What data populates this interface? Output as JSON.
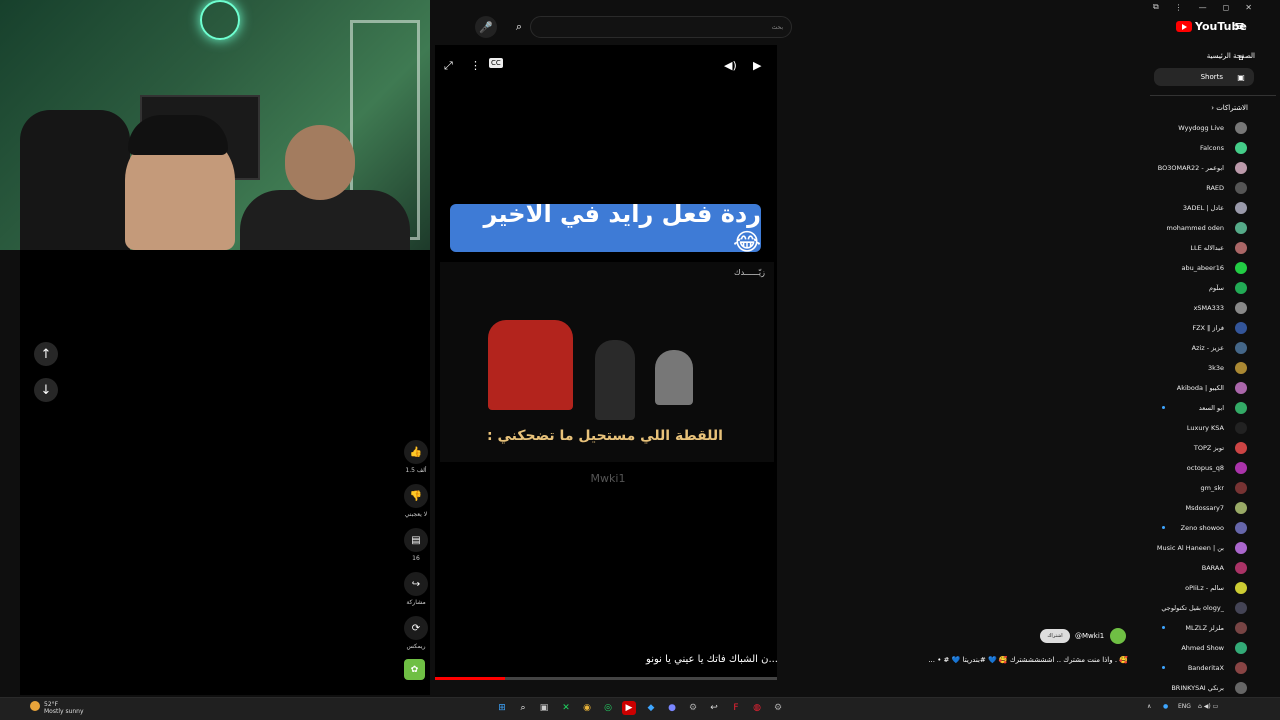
{
  "youtube": {
    "brand": "YouTube",
    "search_text": "بحث",
    "nav_home": "الصفحة الرئيسية",
    "nav_shorts": "Shorts",
    "subs_header": "الاشتراكات"
  },
  "video": {
    "top_caption": "ردة فعل رايد في الاخير 😂",
    "subtitle": "اللقطة اللي مستحيل ما تضحكني :",
    "watermark": "Mwki1",
    "bottom_text": "...ن الشباك فاتك يا عيني يا نونو",
    "progress": 0.205
  },
  "actions": {
    "like_count": "1.5 ألف",
    "dislike_label": "لا يعجبني",
    "comment_count": "16",
    "share_label": "مشاركة",
    "remix_label": "ريمكس"
  },
  "subscriptions": [
    "Wyydogg Live",
    "Falcons",
    "BO3OMAR22 - ابوعمر",
    "RAED",
    "3ADEL | عادل",
    "mohammed oden",
    "LLE عبدالاله",
    "abu_abeer16",
    "سلّوم",
    "xSMA333",
    "FZX ‖ فراز",
    "Aziz - عزيز",
    "3k3e",
    "Akiboda | الكيبو",
    "ابو السعد",
    "Luxury KSA",
    "TOPZ توبز",
    "octopus_q8",
    "gm_skr",
    "Msdossary7",
    "Zeno showoo",
    "Music Al Haneen | بن",
    "BARAA",
    "oPIiLz - سالم",
    "بقيل تكنولوجي ology_",
    "MLZLZ ملزلز",
    "Ahmed Show",
    "BanderitaX",
    "BRINKYSAI برنكي"
  ],
  "chat": {
    "username": "@Mwki1",
    "subscribe": "اشتراك",
    "message": "🥰 . واذا منت مشترك .. اشششششترك 🥰 💙 #بندريتا 💙 # • ..."
  },
  "taskbar": {
    "weather_temp": "52°F",
    "weather_desc": "Mostly sunny",
    "lang": "ENG"
  },
  "colors": {
    "caption_bg": "#3e7bd6",
    "subtitle_fg": "#e8c27a",
    "progress": "#ff0000",
    "brand": "#ff0000"
  }
}
